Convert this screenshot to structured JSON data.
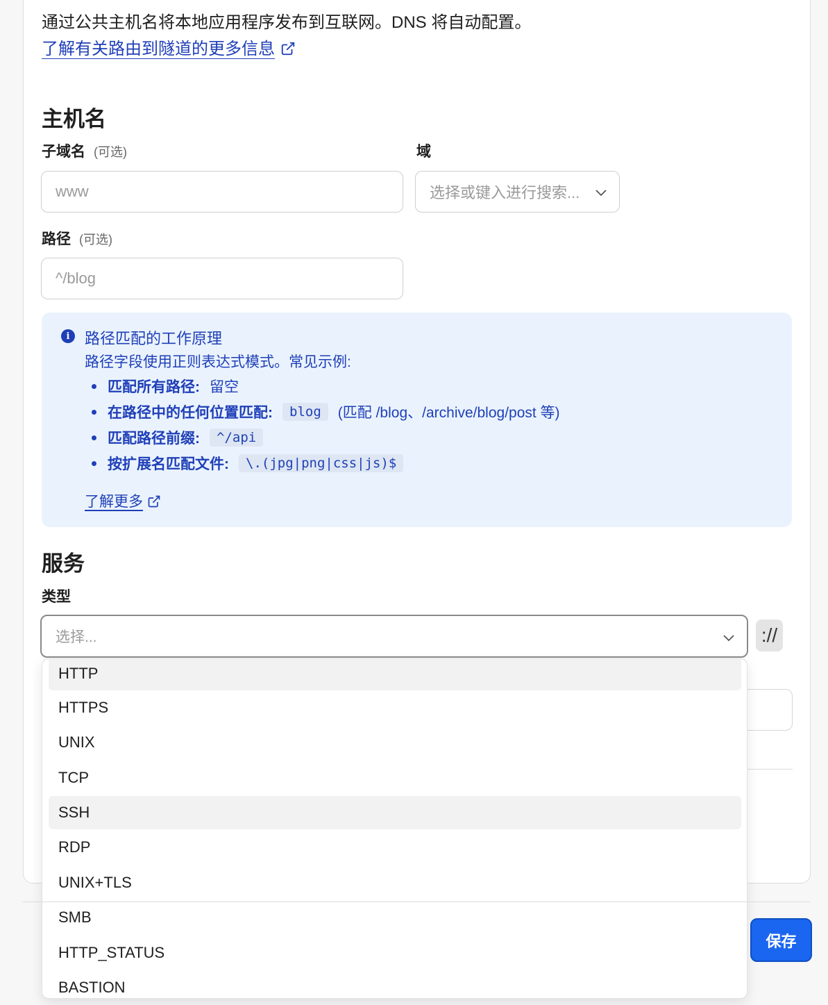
{
  "intro": {
    "text": "通过公共主机名将本地应用程序发布到互联网。DNS 将自动配置。",
    "link": "了解有关路由到隧道的更多信息"
  },
  "hostname": {
    "title": "主机名",
    "subdomain_label": "子域名",
    "subdomain_optional": "(可选)",
    "subdomain_placeholder": "www",
    "domain_label": "域",
    "domain_placeholder": "选择或键入进行搜索...",
    "path_label": "路径",
    "path_optional": "(可选)",
    "path_placeholder": "^/blog"
  },
  "info": {
    "title": "路径匹配的工作原理",
    "desc": "路径字段使用正则表达式模式。常见示例:",
    "items": [
      {
        "label": "匹配所有路径:",
        "value": "留空"
      },
      {
        "label": "在路径中的任何位置匹配:",
        "code": "blog",
        "note": "(匹配 /blog、/archive/blog/post 等)"
      },
      {
        "label": "匹配路径前缀:",
        "code": "^/api"
      },
      {
        "label": "按扩展名匹配文件:",
        "code": "\\.(jpg|png|css|js)$"
      }
    ],
    "link": "了解更多"
  },
  "service": {
    "title": "服务",
    "type_label": "类型",
    "type_placeholder": "选择...",
    "scheme_badge": "://",
    "options": [
      "HTTP",
      "HTTPS",
      "UNIX",
      "TCP",
      "SSH",
      "RDP",
      "UNIX+TLS",
      "SMB",
      "HTTP_STATUS",
      "BASTION"
    ]
  },
  "footer": {
    "save_label": "保存"
  },
  "colors": {
    "accent": "#1a66f0",
    "link": "#1f3fb8",
    "info_bg": "#eaf3fd"
  }
}
